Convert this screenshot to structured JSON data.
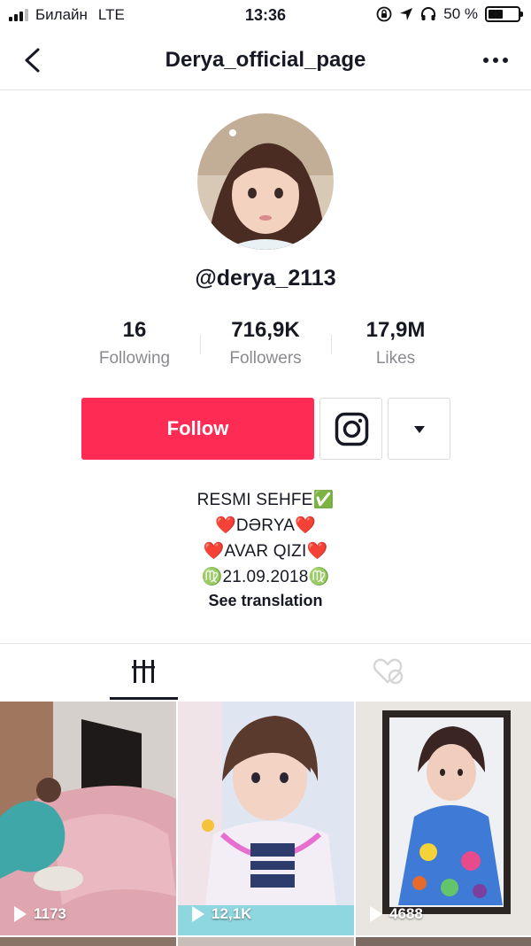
{
  "status_bar": {
    "carrier": "Билайн",
    "network": "LTE",
    "time": "13:36",
    "battery": "50 %",
    "battery_level": 0.5
  },
  "nav": {
    "title": "Derya_official_page"
  },
  "profile": {
    "username": "@derya_2113",
    "stats": [
      {
        "value": "16",
        "label": "Following"
      },
      {
        "value": "716,9K",
        "label": "Followers"
      },
      {
        "value": "17,9M",
        "label": "Likes"
      }
    ],
    "follow_label": "Follow",
    "bio_lines": [
      "RESMI SEHFE✅",
      "❤️DƏRYA❤️",
      "❤️AVAR QIZI❤️",
      "♍21.09.2018♍"
    ],
    "see_translation": "See translation"
  },
  "colors": {
    "accent": "#fe2c55",
    "text": "#161823",
    "secondary_text": "#8a8b91"
  },
  "icons": {
    "back": "chevron-left-icon",
    "more": "more-horizontal-icon",
    "instagram": "instagram-icon",
    "dropdown": "caret-down-icon",
    "grid_tab": "videos-grid-icon",
    "liked_tab": "liked-hidden-icon",
    "play": "play-icon"
  },
  "videos": [
    {
      "views": "1173"
    },
    {
      "views": "12,1K"
    },
    {
      "views": "4688"
    }
  ]
}
